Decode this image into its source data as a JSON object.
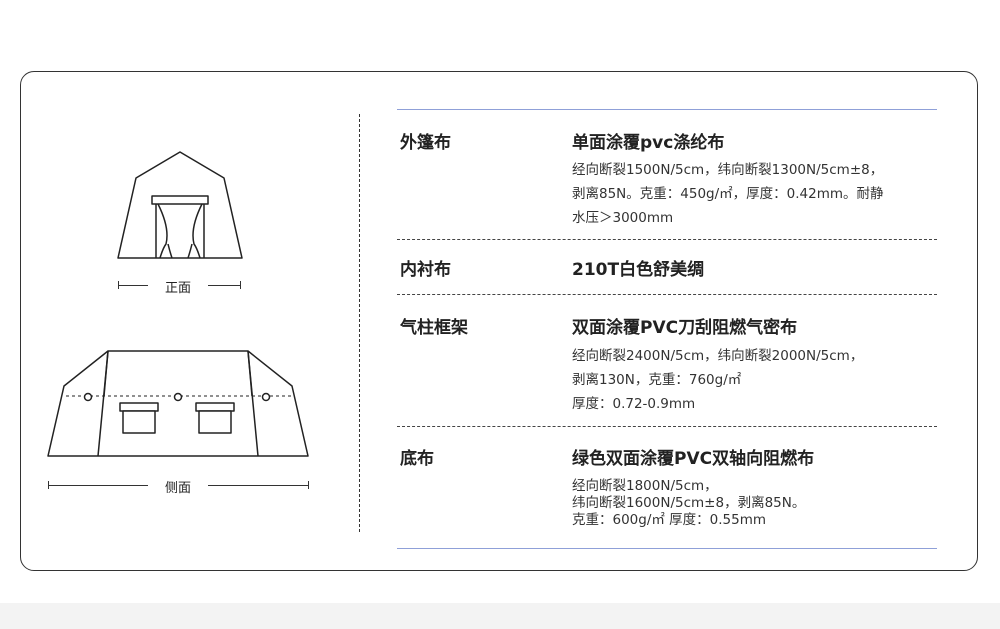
{
  "illustrations": {
    "front_label": "正面",
    "side_label": "侧面"
  },
  "specs": [
    {
      "name": "外篷布",
      "title": "单面涂覆pvc涤纶布",
      "detail": "经向断裂1500N/5cm，纬向断裂1300N/5cm±8，\n剥离85N。克重：450g/㎡，厚度：0.42mm。耐静\n水压＞3000mm"
    },
    {
      "name": "内衬布",
      "title": "210T白色舒美绸",
      "detail": ""
    },
    {
      "name": "气柱框架",
      "title": "双面涂覆PVC刀刮阻燃气密布",
      "detail": "经向断裂2400N/5cm，纬向断裂2000N/5cm，\n剥离130N，克重：760g/㎡\n厚度：0.72-0.9mm"
    },
    {
      "name": "底布",
      "title": "绿色双面涂覆PVC双轴向阻燃布",
      "detail": "经向断裂1800N/5cm，\n纬向断裂1600N/5cm±8，剥离85N。\n克重：600g/㎡    厚度：0.55mm"
    }
  ],
  "colors": {
    "accent_rule": "#8fa0d8",
    "border": "#333333"
  }
}
